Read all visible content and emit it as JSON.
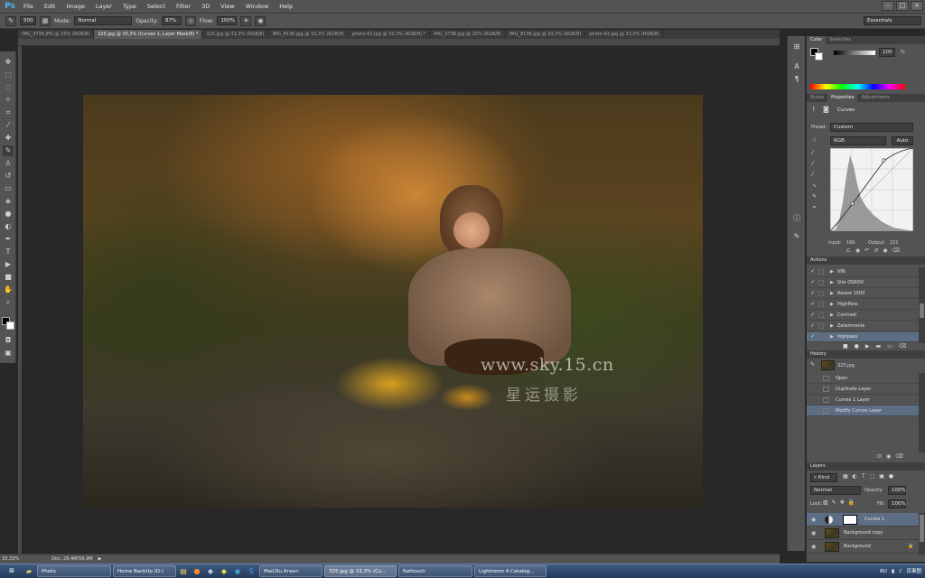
{
  "app": {
    "logo": "Ps",
    "menu": [
      "File",
      "Edit",
      "Image",
      "Layer",
      "Type",
      "Select",
      "Filter",
      "3D",
      "View",
      "Window",
      "Help"
    ],
    "window_controls": [
      "–",
      "□",
      "×"
    ]
  },
  "options_bar": {
    "brush_size": "500",
    "mode_label": "Mode:",
    "mode_value": "Normal",
    "opacity_label": "Opacity:",
    "opacity_value": "87%",
    "flow_label": "Flow:",
    "flow_value": "100%",
    "workspace": "Essentials"
  },
  "tabs": [
    {
      "label": "IMG_3738.JPG @ 25% (RGB/8)",
      "active": false
    },
    {
      "label": "325.jpg @ 33,3% (Curves 1, Layer Mask/8) *",
      "active": true
    },
    {
      "label": "325.jpg @ 33,3% (RGB/8)",
      "active": false
    },
    {
      "label": "IMG_8136.jpg @ 33,3% (RGB/8)",
      "active": false
    },
    {
      "label": "photo-63.jpg @ 33,3% (RGB/8) *",
      "active": false
    },
    {
      "label": "IMG_3738.jpg @ 25% (RGB/8)",
      "active": false
    },
    {
      "label": "IMG_8136.jpg @ 33,3% (RGB/8)",
      "active": false
    },
    {
      "label": "photo-63.jpg @ 33,3% (RGB/8)",
      "active": false
    }
  ],
  "canvas": {
    "watermark_url": "www.sky.15.cn",
    "watermark_cn": "星运摄影"
  },
  "status": {
    "zoom": "33,33%",
    "doc": "Doc: 28,4M/56,9M"
  },
  "color_panel": {
    "tabs": [
      "Color",
      "Swatches"
    ],
    "value": "100",
    "unit": "%",
    "spectrum_colors": [
      "#ff0000",
      "#ffff00",
      "#00ff00",
      "#00ffff",
      "#0000ff",
      "#ff00ff",
      "#ff0000"
    ]
  },
  "properties_panel": {
    "tabs": [
      "Styles",
      "Properties",
      "Adjustments"
    ],
    "title": "Curves",
    "preset_label": "Preset:",
    "preset_value": "Custom",
    "channel": "RGB",
    "auto_label": "Auto",
    "input_label": "Input:",
    "input_value": "166",
    "output_label": "Output:",
    "output_value": "221"
  },
  "actions_panel": {
    "title": "Actions",
    "items": [
      "VIN",
      "Site OSROV",
      "Resize 1500",
      "HighPass",
      "Contrast",
      "Zatemnenie",
      "highpass"
    ],
    "selected_index": 6
  },
  "history_panel": {
    "title": "History",
    "snapshot": "325.jpg",
    "items": [
      "Open",
      "Duplicate Layer",
      "Curves 1 Layer",
      "Modify Curves Layer"
    ],
    "selected_index": 3
  },
  "layers_panel": {
    "title": "Layers",
    "kind_label": "Kind",
    "blend_mode": "Normal",
    "opacity_label": "Opacity:",
    "opacity_value": "100%",
    "lock_label": "Lock:",
    "fill_label": "Fill:",
    "fill_value": "100%",
    "layers": [
      {
        "name": "Curves 1",
        "selected": true
      },
      {
        "name": "Background copy",
        "selected": false
      },
      {
        "name": "Background",
        "selected": false
      }
    ]
  },
  "taskbar": {
    "start": "⊞",
    "items": [
      "Photo",
      "Home BackUp (D:)",
      "Mail.Ru Агент",
      "325.jpg @ 33,3% (Cu...",
      "Rattouch",
      "Lightroom 4 Catalog..."
    ],
    "tray_lang": "RU",
    "tray_site": "百事图"
  }
}
